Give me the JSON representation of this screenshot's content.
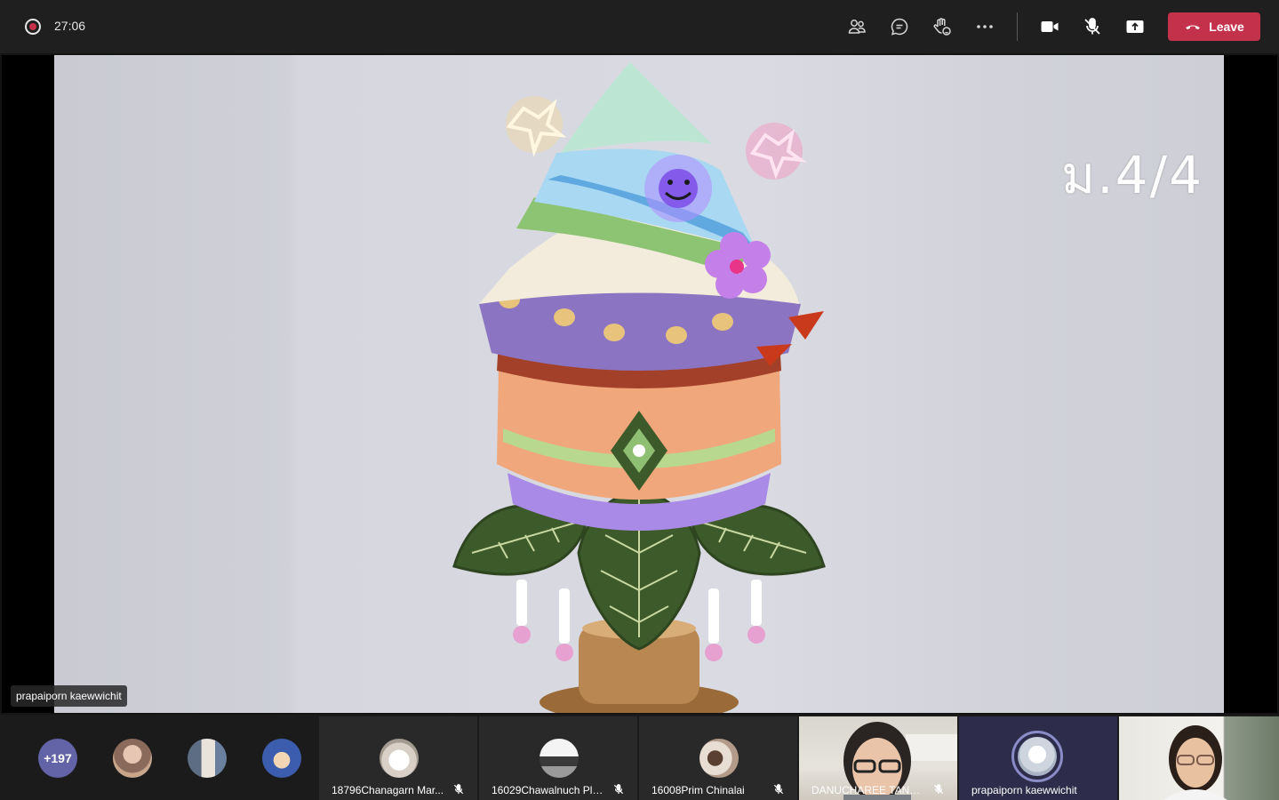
{
  "meeting": {
    "elapsed": "27:06"
  },
  "toolbar": {
    "participants_icon": "people-icon",
    "chat_icon": "chat-icon",
    "reactions_icon": "raise-hand-icon",
    "more_icon": "more-icon",
    "camera_icon": "camera-icon",
    "mic_icon": "mic-off-icon",
    "share_icon": "share-screen-icon",
    "leave_label": "Leave",
    "leave_color": "#c4314b"
  },
  "stage": {
    "overlay_text": "ม.4/4",
    "presenter_name": "prapaiporn kaewwichit"
  },
  "overflow_count": "+197",
  "tiles": [
    {
      "name": "18796Chanagarn Mar...",
      "muted": true
    },
    {
      "name": "16029Chawalnuch Plu...",
      "muted": true
    },
    {
      "name": "16008Prim Chinalai",
      "muted": true
    },
    {
      "name": "DANUCHAREE TANTH...",
      "muted": true
    },
    {
      "name": "prapaiporn kaewwichit",
      "muted": false
    }
  ],
  "colors": {
    "accent": "#6264a7",
    "topbar": "#1f1f1f"
  }
}
